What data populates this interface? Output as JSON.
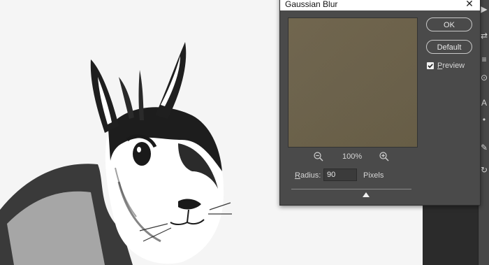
{
  "dialog": {
    "title": "Gaussian Blur",
    "buttons": {
      "ok": "OK",
      "default": "Default"
    },
    "preview": {
      "label": "Preview",
      "checked": true
    },
    "zoom_level": "100%",
    "radius": {
      "label": "Radius:",
      "value": "90",
      "unit": "Pixels"
    },
    "slider_fraction": 0.62
  },
  "colors": {
    "preview_fill": "#6b614a",
    "dialog_bg": "#4a4a4a"
  },
  "icons": [
    "zoom-out-icon",
    "zoom-in-icon",
    "close-icon",
    "checkbox-checked-icon"
  ]
}
